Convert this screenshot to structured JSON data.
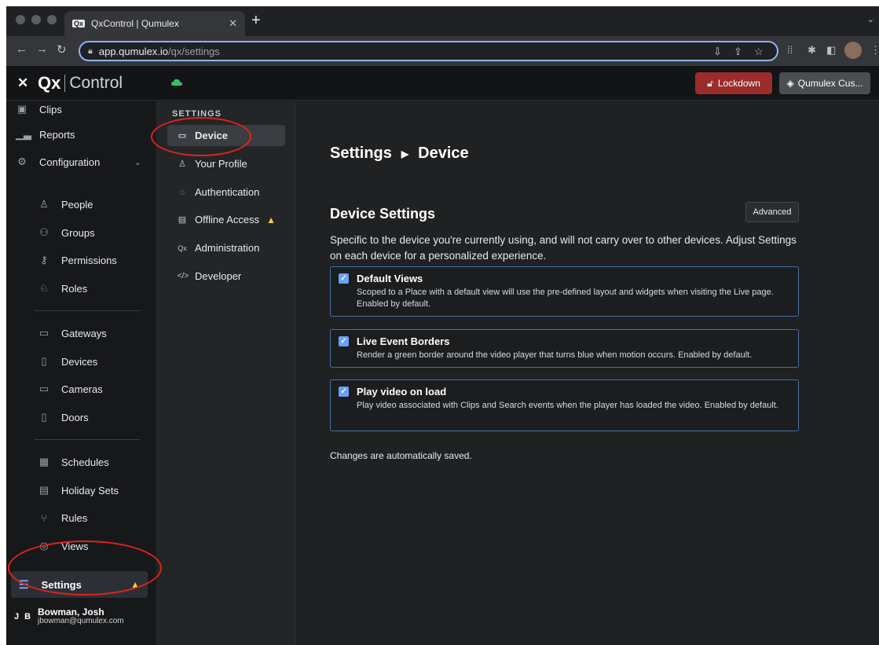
{
  "browser": {
    "tab_title": "QxControl | Qumulex",
    "favicon_text": "Qx",
    "url_domain": "app.qumulex.io",
    "url_path": "/qx/settings"
  },
  "header": {
    "logo_mark": "Qx",
    "logo_text": "Control",
    "lockdown_label": "Lockdown",
    "customer_label": "Qumulex Cus..."
  },
  "sidebar": {
    "items": [
      {
        "label": "Clips",
        "icon": "clips-icon"
      },
      {
        "label": "Reports",
        "icon": "bar-chart-icon"
      },
      {
        "label": "Configuration",
        "icon": "gear-icon"
      },
      {
        "label": "People",
        "icon": "person-icon"
      },
      {
        "label": "Groups",
        "icon": "group-icon"
      },
      {
        "label": "Permissions",
        "icon": "key-icon"
      },
      {
        "label": "Roles",
        "icon": "role-icon"
      },
      {
        "label": "Gateways",
        "icon": "gateway-icon"
      },
      {
        "label": "Devices",
        "icon": "device-icon"
      },
      {
        "label": "Cameras",
        "icon": "camera-icon"
      },
      {
        "label": "Doors",
        "icon": "door-icon"
      },
      {
        "label": "Schedules",
        "icon": "calendar-icon"
      },
      {
        "label": "Holiday Sets",
        "icon": "holiday-icon"
      },
      {
        "label": "Rules",
        "icon": "rules-icon"
      },
      {
        "label": "Views",
        "icon": "eye-icon"
      }
    ],
    "settings_label": "Settings",
    "user": {
      "initials": "J B",
      "name": "Bowman, Josh",
      "email": "jbowman@qumulex.com"
    }
  },
  "settings_nav": {
    "heading": "SETTINGS",
    "items": [
      {
        "label": "Device",
        "icon": "device-icon"
      },
      {
        "label": "Your Profile",
        "icon": "person-icon"
      },
      {
        "label": "Authentication",
        "icon": "fingerprint-icon"
      },
      {
        "label": "Offline Access",
        "icon": "server-icon"
      },
      {
        "label": "Administration",
        "icon": "qx-icon"
      },
      {
        "label": "Developer",
        "icon": "code-icon"
      }
    ]
  },
  "main": {
    "breadcrumb_root": "Settings",
    "breadcrumb_current": "Device",
    "section_title": "Device Settings",
    "advanced_label": "Advanced",
    "description": "Specific to the device you're currently using, and will not carry over to other devices. Adjust Settings on each device for a personalized experience.",
    "options": [
      {
        "title": "Default Views",
        "desc": "Scoped to a Place with a default view will use the pre-defined layout and widgets when visiting the Live page. Enabled by default.",
        "checked": true
      },
      {
        "title": "Live Event Borders",
        "desc": "Render a green border around the video player that turns blue when motion occurs. Enabled by default.",
        "checked": true
      },
      {
        "title": "Play video on load",
        "desc": "Play video associated with Clips and Search events when the player has loaded the video. Enabled by default.",
        "checked": true
      }
    ],
    "saved_note": "Changes are automatically saved."
  },
  "colors": {
    "accent": "#7aa7ff",
    "lockdown": "#9b2c2c",
    "warning": "#f2c94c",
    "annotation": "#e0231c"
  }
}
